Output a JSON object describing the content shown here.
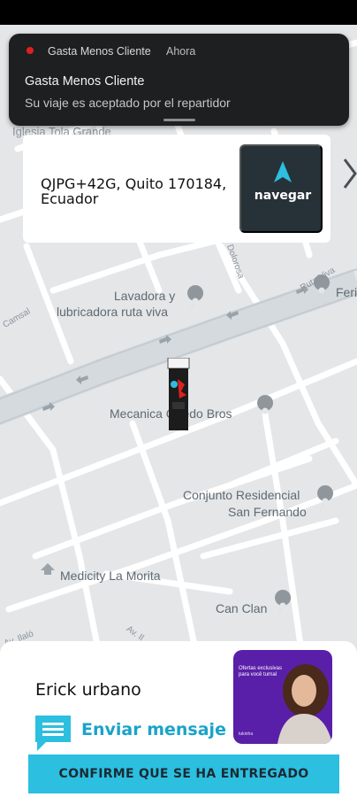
{
  "notification": {
    "app_name": "Gasta Menos Cliente",
    "time": "Ahora",
    "title": "Gasta Menos Cliente",
    "body": "Su viaje es aceptado por el repartidor"
  },
  "address_card": {
    "address": "QJPG+42G, Quito 170184, Ecuador",
    "nav_label": "navegar"
  },
  "map": {
    "poi": {
      "iglesia": "Iglesia Tola Grande",
      "lavadora_1": "Lavadora y",
      "lavadora_2": "lubricadora ruta viva",
      "mecanica": "Mecanica Onedo Bros",
      "conjunto_1": "Conjunto Residencial",
      "conjunto_2": "San Fernando",
      "medicity": "Medicity La Morita",
      "can_clan": "Can Clan",
      "feri": "Feri"
    },
    "streets": {
      "camsal": "Camsal",
      "ruta_viva": "Ruta Viva",
      "dolorosa": "Dolorosa",
      "av_ilalo_1": "Av. Ilaló",
      "av_ilalo_2": "Av. Il"
    }
  },
  "bottom_sheet": {
    "driver_name": "Erick urbano",
    "message_label": "Enviar mensaje",
    "confirm_label": "CONFIRME QUE SE HA ENTREGADO",
    "ad": {
      "text": "Ofertas exclusivas para você turnal",
      "brand": "tukinha"
    }
  },
  "colors": {
    "accent": "#2cbfe0",
    "message_text": "#1aa3c9",
    "nav_button": "#263238",
    "ad_background": "#5a1fa8"
  }
}
